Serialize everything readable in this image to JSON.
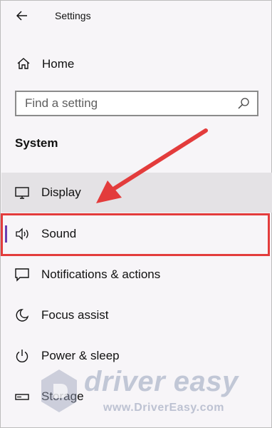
{
  "window": {
    "title": "Settings"
  },
  "nav": {
    "home_label": "Home",
    "section_title": "System",
    "items": [
      {
        "label": "Display",
        "icon": "monitor-icon"
      },
      {
        "label": "Sound",
        "icon": "speaker-icon"
      },
      {
        "label": "Notifications & actions",
        "icon": "notification-icon"
      },
      {
        "label": "Focus assist",
        "icon": "moon-icon"
      },
      {
        "label": "Power & sleep",
        "icon": "power-icon"
      },
      {
        "label": "Storage",
        "icon": "storage-icon"
      }
    ],
    "active_item": "Sound",
    "hovered_item": "Display"
  },
  "search": {
    "placeholder": "Find a setting"
  },
  "annotation": {
    "highlight_color": "#e33c3c",
    "accent_color": "#6b3fb0"
  },
  "watermark": {
    "brand": "driver easy",
    "url": "www.DriverEasy.com"
  }
}
